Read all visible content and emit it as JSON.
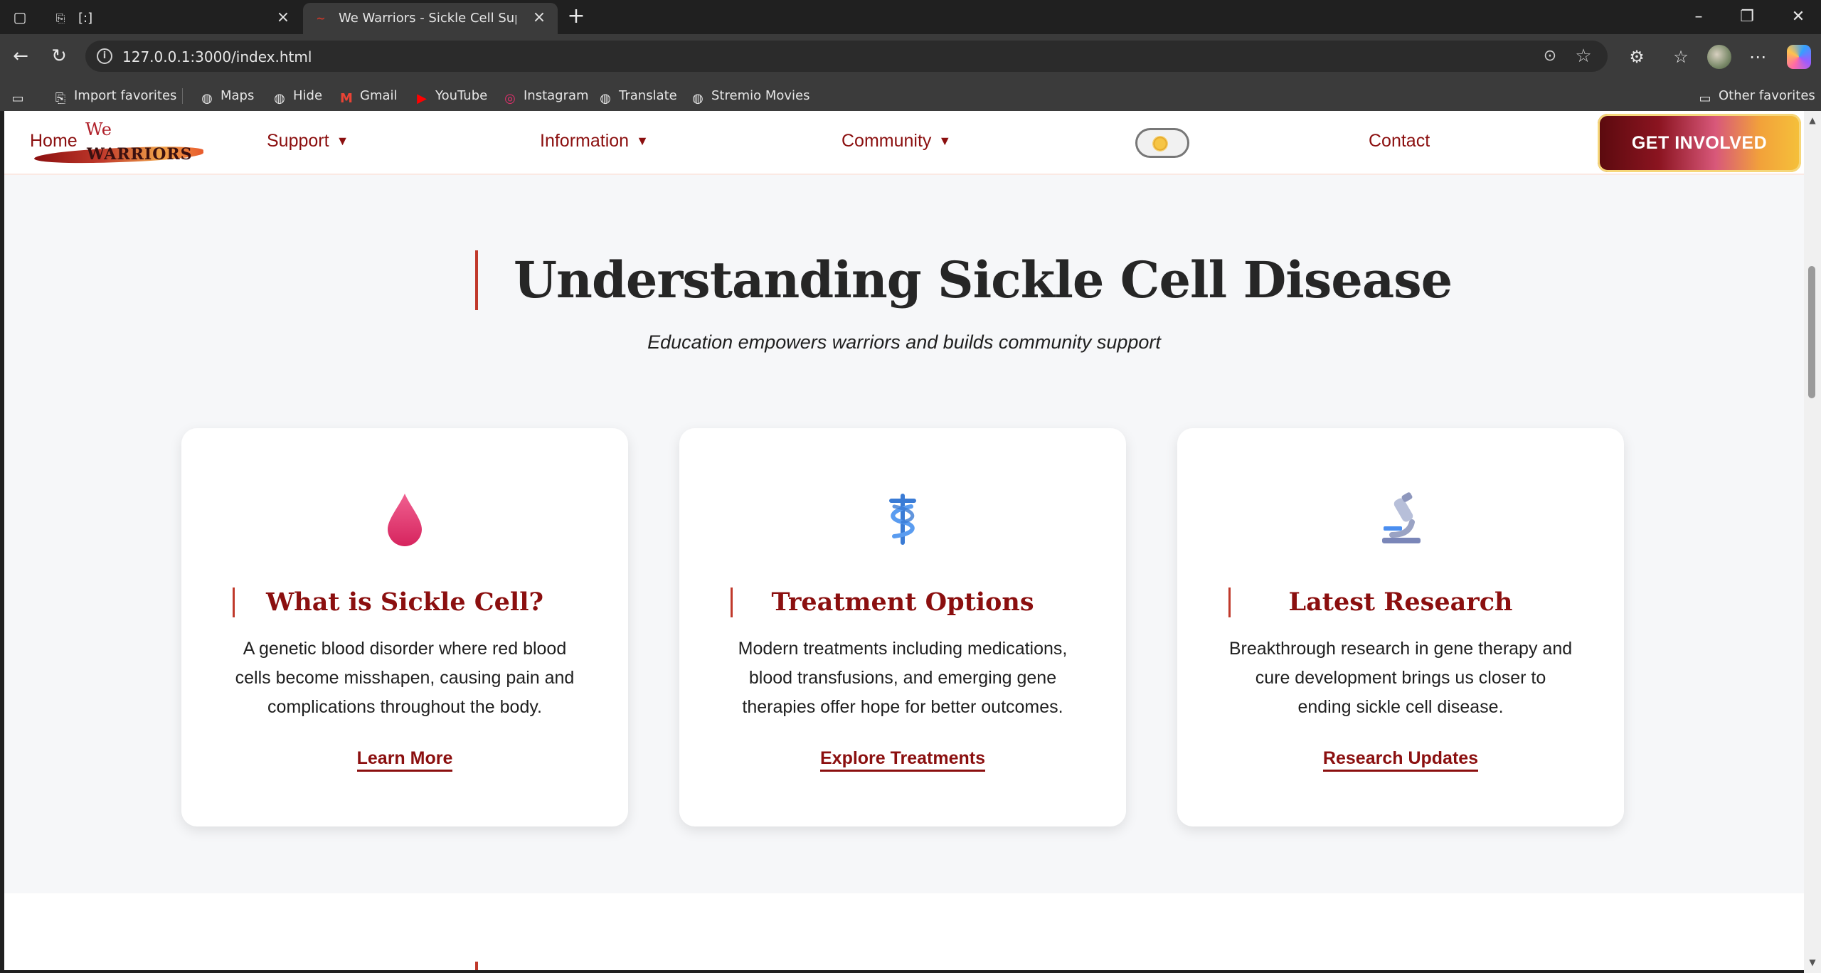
{
  "browser": {
    "tabs": [
      {
        "title": "[:]",
        "active": false
      },
      {
        "title": "We Warriors - Sickle Cell Support",
        "active": true
      }
    ],
    "url": "127.0.0.1:3000/index.html",
    "favorites": [
      {
        "label": "Import favorites",
        "icon": "import-icon"
      },
      {
        "label": "Maps",
        "icon": "globe-icon"
      },
      {
        "label": "Hide",
        "icon": "globe-icon"
      },
      {
        "label": "Gmail",
        "icon": "gmail-icon"
      },
      {
        "label": "YouTube",
        "icon": "youtube-icon"
      },
      {
        "label": "Instagram",
        "icon": "instagram-icon"
      },
      {
        "label": "Translate",
        "icon": "globe-icon"
      },
      {
        "label": "Stremio Movies",
        "icon": "globe-icon"
      }
    ],
    "other_favorites": "Other favorites"
  },
  "site": {
    "logo": {
      "we": "We",
      "wordmark": "WARRIORS"
    },
    "nav": {
      "home": "Home",
      "support": "Support",
      "information": "Information",
      "community": "Community",
      "caret": "▼",
      "contact": "Contact",
      "cta": "GET INVOLVED"
    },
    "section": {
      "title": "Understanding Sickle Cell Disease",
      "subtitle": "Education empowers warriors and builds community support"
    },
    "cards": [
      {
        "icon": "blood-drop-icon",
        "title": "What is Sickle Cell?",
        "description": "A genetic blood disorder where red blood cells become misshapen, causing pain and complications throughout the body.",
        "link": "Learn More"
      },
      {
        "icon": "medical-symbol-icon",
        "title": "Treatment Options",
        "description": "Modern treatments including medications, blood transfusions, and emerging gene therapies offer hope for better outcomes.",
        "link": "Explore Treatments"
      },
      {
        "icon": "microscope-icon",
        "title": "Latest Research",
        "description": "Breakthrough research in gene therapy and cure development brings us closer to ending sickle cell disease.",
        "link": "Research Updates"
      }
    ]
  },
  "colors": {
    "brand": "#8b0f0f",
    "accent_bar": "#c0392b",
    "page_bg": "#f6f7f9"
  }
}
